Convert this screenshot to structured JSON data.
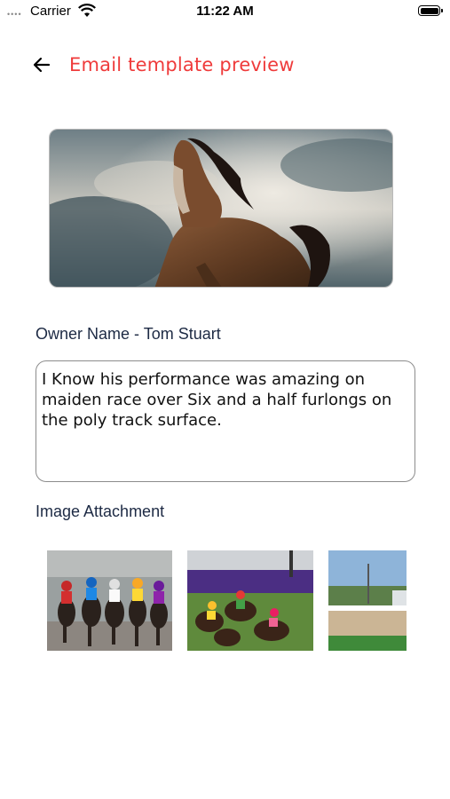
{
  "status_bar": {
    "carrier": "Carrier",
    "time": "11:22 AM",
    "signal": "••••"
  },
  "header": {
    "title": "Email template preview",
    "back_icon": "arrow-left-icon"
  },
  "owner_line": "Owner Name - Tom Stuart",
  "message": "I Know his performance was amazing on maiden race over Six and a half furlongs on the poly track surface.",
  "attachments": {
    "label": "Image Attachment",
    "images": [
      "race-photo-1",
      "race-photo-2",
      "race-photo-3"
    ]
  },
  "colors": {
    "title": "#ef3b3b",
    "label": "#1d2a44",
    "border": "#8c8c8c"
  }
}
